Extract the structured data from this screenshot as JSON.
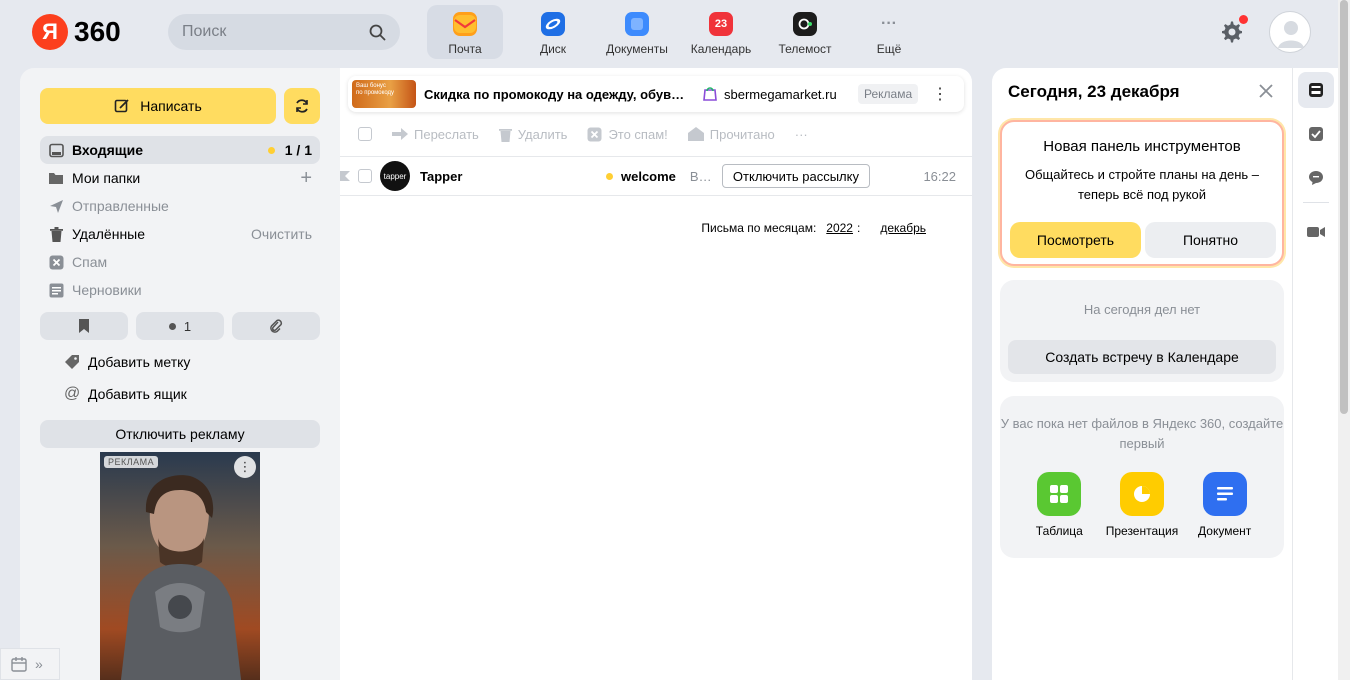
{
  "header": {
    "logo_letter": "Я",
    "logo_text": "360",
    "search_placeholder": "Поиск",
    "services": [
      {
        "label": "Почта",
        "color": "#ff9f1a"
      },
      {
        "label": "Диск",
        "color": "#1f6fe5"
      },
      {
        "label": "Документы",
        "color": "#3d8bfd"
      },
      {
        "label": "Календарь",
        "color": "#f0333a",
        "badge": "23"
      },
      {
        "label": "Телемост",
        "color": "#1c1c1c"
      },
      {
        "label": "Ещё",
        "color": "#8a8f96"
      }
    ]
  },
  "sidebar": {
    "compose_label": "Написать",
    "folders": [
      {
        "label": "Входящие",
        "count": "1 / 1",
        "icon": "inbox-icon"
      },
      {
        "label": "Мои папки",
        "icon": "folder-icon",
        "action": "+"
      },
      {
        "label": "Отправленные",
        "icon": "sent-icon"
      },
      {
        "label": "Удалённые",
        "icon": "trash-icon",
        "action": "Очистить"
      },
      {
        "label": "Спам",
        "icon": "spam-icon"
      },
      {
        "label": "Черновики",
        "icon": "draft-icon"
      }
    ],
    "filter_unread_count": "1",
    "add_label": "Добавить метку",
    "add_mailbox": "Добавить ящик",
    "disable_ads": "Отключить рекламу",
    "ad_label": "РЕКЛАМА"
  },
  "mail": {
    "ad": {
      "title": "Скидка по промокоду на одежду, обув…",
      "site": "sbermegamarket.ru",
      "badge": "Реклама",
      "thumb_text": "Ваш бонус\nпо промокоду"
    },
    "toolbar": {
      "forward": "Переслать",
      "delete": "Удалить",
      "spam": "Это спам!",
      "read": "Прочитано",
      "more": "···"
    },
    "messages": [
      {
        "avatar_text": "tapper",
        "from": "Tapper",
        "subject": "welcome",
        "snippet": "В…",
        "unsubscribe": "Отключить рассылку",
        "time": "16:22"
      }
    ],
    "months": {
      "label": "Письма по месяцам:",
      "year": "2022",
      "month": "декабрь"
    }
  },
  "right_panel": {
    "title": "Сегодня, 23 декабря",
    "promo": {
      "title": "Новая панель инструментов",
      "text": "Общайтесь и стройте планы на день – теперь всё под рукой",
      "primary": "Посмотреть",
      "secondary": "Понятно"
    },
    "todo": {
      "empty": "На сегодня дел нет",
      "button": "Создать встречу в Календаре"
    },
    "files": {
      "empty": "У вас пока нет файлов в Яндекс 360, создайте первый",
      "items": [
        {
          "label": "Таблица",
          "color": "#5ac832"
        },
        {
          "label": "Презентация",
          "color": "#ffcc00"
        },
        {
          "label": "Документ",
          "color": "#2f6ff0"
        }
      ]
    }
  },
  "colors": {
    "accent_yellow": "#ffdc60",
    "logo_red": "#fc3f1d",
    "notification_red": "#ff3333"
  }
}
